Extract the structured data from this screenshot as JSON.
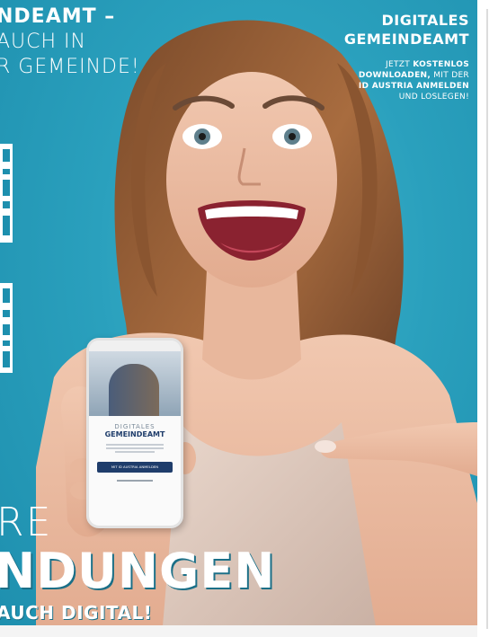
{
  "headline": {
    "line1": "NDEAMT –",
    "line2": "AUCH IN",
    "line3": "R GEMEINDE!"
  },
  "side": {
    "title_line1": "DIGITALES",
    "title_line2": "GEMEINDEAMT",
    "copy_line1_plain": "JETZT ",
    "copy_line1_bold": "KOSTENLOS",
    "copy_line2_bold": "DOWNLOADEN,",
    "copy_line2_plain": " MIT DER",
    "copy_line3_bold": "ID AUSTRIA ANMELDEN",
    "copy_line4_plain": "UND LOSLEGEN!"
  },
  "phone": {
    "app_title_line1": "DIGITALES",
    "app_title_line2": "GEMEINDEAMT",
    "button_label": "MIT ID AUSTRIA ANMELDEN"
  },
  "bottom": {
    "line1": "RE",
    "line2": "NDUNGEN",
    "line3": "AUCH DIGITAL!"
  },
  "colors": {
    "background_teal": "#2aa0bd",
    "text": "#ffffff",
    "app_navy": "#1f3d6b"
  }
}
